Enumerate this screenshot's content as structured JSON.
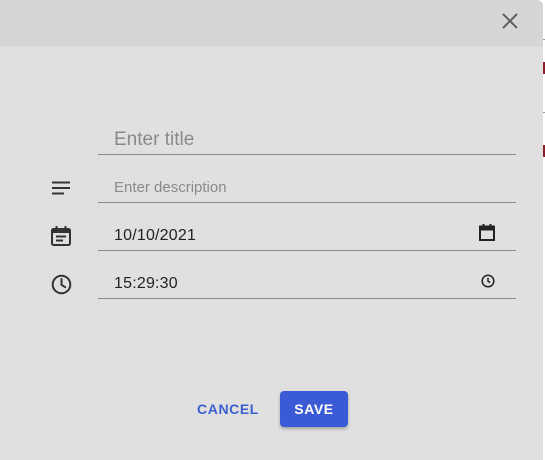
{
  "dialog": {
    "close_icon": "close-icon",
    "title_field": {
      "placeholder": "Enter title",
      "value": ""
    },
    "description_field": {
      "icon": "notes-icon",
      "placeholder": "Enter description",
      "value": ""
    },
    "date_field": {
      "icon": "event-icon",
      "value": "10/10/2021",
      "picker_icon": "calendar-icon"
    },
    "time_field": {
      "icon": "clock-icon",
      "value": "15:29:30",
      "picker_icon": "clock-icon"
    },
    "actions": {
      "cancel_label": "CANCEL",
      "save_label": "SAVE"
    }
  },
  "colors": {
    "dialog_bg": "#e0e0e0",
    "header_bg": "#d6d6d6",
    "primary": "#3b5bd6",
    "cancel_text": "#3a5fd0"
  }
}
